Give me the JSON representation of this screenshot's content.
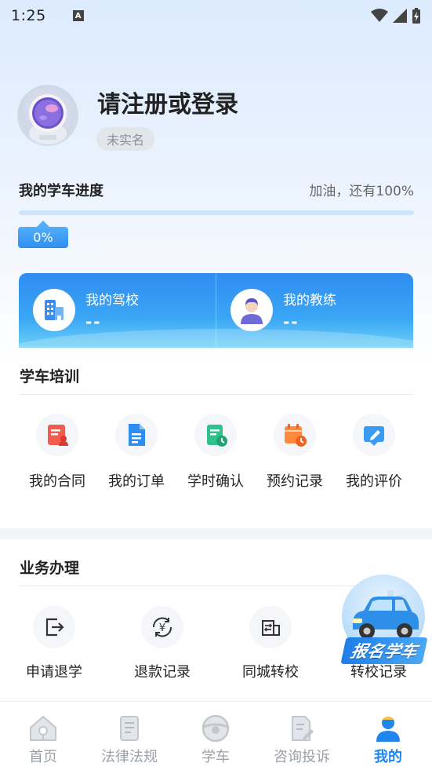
{
  "status_bar": {
    "time": "1:25",
    "notification": "A"
  },
  "profile": {
    "title": "请注册或登录",
    "badge": "未实名"
  },
  "progress": {
    "title": "我的学车进度",
    "hint": "加油，还有100%",
    "percent_label": "0%",
    "value": 0
  },
  "school_card": {
    "school_label": "我的驾校",
    "school_value": "--",
    "coach_label": "我的教练",
    "coach_value": "--"
  },
  "training": {
    "title": "学车培训",
    "items": [
      {
        "label": "我的合同",
        "icon": "contract-icon"
      },
      {
        "label": "我的订单",
        "icon": "order-icon"
      },
      {
        "label": "学时确认",
        "icon": "hours-confirm-icon"
      },
      {
        "label": "预约记录",
        "icon": "booking-record-icon"
      },
      {
        "label": "我的评价",
        "icon": "review-icon"
      }
    ]
  },
  "business": {
    "title": "业务办理",
    "items": [
      {
        "label": "申请退学",
        "icon": "withdraw-icon"
      },
      {
        "label": "退款记录",
        "icon": "refund-icon"
      },
      {
        "label": "同城转校",
        "icon": "transfer-icon"
      },
      {
        "label": "转校记录",
        "icon": "transfer-record-icon"
      }
    ]
  },
  "float_button": {
    "label": "报名学车"
  },
  "tabbar": {
    "items": [
      {
        "label": "首页",
        "icon": "home-icon"
      },
      {
        "label": "法律法规",
        "icon": "law-icon"
      },
      {
        "label": "学车",
        "icon": "steering-wheel-icon"
      },
      {
        "label": "咨询投诉",
        "icon": "complaint-icon"
      },
      {
        "label": "我的",
        "icon": "profile-icon"
      }
    ],
    "active": 4
  },
  "colors": {
    "accent": "#1f86f0",
    "tab_inactive": "#9aa0a8",
    "card_blue": "#2f8cf0"
  }
}
